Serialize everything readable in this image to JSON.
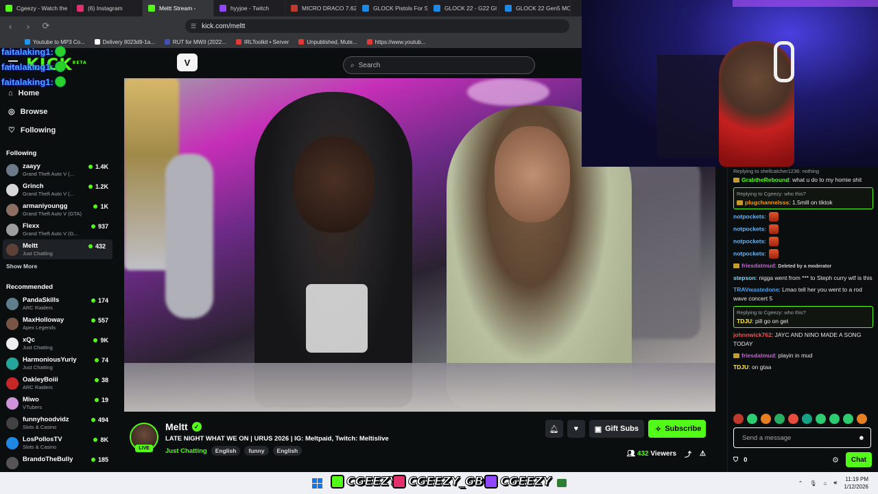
{
  "browser": {
    "tabs": [
      {
        "label": "Cgeezy - Watch the",
        "color": "#53fc18",
        "active": false
      },
      {
        "label": "(6) Instagram",
        "color": "#e1306c",
        "active": false
      },
      {
        "label": "Meltt Stream -",
        "color": "#53fc18",
        "active": true
      },
      {
        "label": "hyyjoe - Twitch",
        "color": "#9146ff",
        "active": false
      },
      {
        "label": "MICRO DRACO 7.62",
        "color": "#c0392b",
        "active": false
      },
      {
        "label": "GLOCK Pistols For S",
        "color": "#1e88e5",
        "active": false
      },
      {
        "label": "GLOCK 22 - G22 Gl",
        "color": "#1e88e5",
        "active": false
      },
      {
        "label": "GLOCK 22 Gen5 MO",
        "color": "#1e88e5",
        "active": false
      }
    ],
    "url": "kick.com/meltt",
    "bookmarks": [
      {
        "label": "Youtube to MP3 Co...",
        "color": "#2196f3"
      },
      {
        "label": "Delivery 8023d9-1a...",
        "color": "#ffffff"
      },
      {
        "label": "RUT for MWII (2022...",
        "color": "#3f51b5"
      },
      {
        "label": "IRLToolkit • Server",
        "color": "#e53935"
      },
      {
        "label": "Unpublished, Mute...",
        "color": "#e53935"
      },
      {
        "label": "https://www.youtub...",
        "color": "#e53935"
      }
    ]
  },
  "kick": {
    "logo": "KICK",
    "logo_beta": "BETA",
    "search_placeholder": "Search",
    "nav": [
      {
        "label": "Home",
        "icon": "home-icon"
      },
      {
        "label": "Browse",
        "icon": "compass-icon"
      },
      {
        "label": "Following",
        "icon": "heart-icon"
      }
    ],
    "following_header": "Following",
    "following": [
      {
        "name": "zaayy",
        "game": "Grand Theft Auto V (...",
        "viewers": "1.4K",
        "color": "#6c7a89"
      },
      {
        "name": "Grinch",
        "game": "Grand Theft Auto V (...",
        "viewers": "1.2K",
        "color": "#d8d8d8"
      },
      {
        "name": "armaniyoungg",
        "game": "Grand Theft Auto V (GTA)",
        "viewers": "1K",
        "color": "#8d6e63"
      },
      {
        "name": "Flexx",
        "game": "Grand Theft Auto V (G...",
        "viewers": "937",
        "color": "#9e9e9e"
      },
      {
        "name": "Meltt",
        "game": "Just Chatting",
        "viewers": "432",
        "color": "#5d4037"
      }
    ],
    "show_more": "Show More",
    "recommended_header": "Recommended",
    "recommended": [
      {
        "name": "PandaSkills",
        "game": "ARC Raiders",
        "viewers": "174",
        "color": "#607d8b"
      },
      {
        "name": "MaxHolloway",
        "game": "Apex Legends",
        "viewers": "557",
        "color": "#795548"
      },
      {
        "name": "xQc",
        "game": "Just Chatting",
        "viewers": "9K",
        "color": "#eeeeee"
      },
      {
        "name": "HarmoniousYuriy",
        "game": "Just Chatting",
        "viewers": "74",
        "color": "#26a69a"
      },
      {
        "name": "OakleyBoiii",
        "game": "ARC Raiders",
        "viewers": "38",
        "color": "#c62828"
      },
      {
        "name": "Miwo",
        "game": "VTubers",
        "viewers": "19",
        "color": "#ce93d8"
      },
      {
        "name": "funnyhoodvidz",
        "game": "Slots & Casino",
        "viewers": "494",
        "color": "#424242"
      },
      {
        "name": "LosPollosTV",
        "game": "Slots & Casino",
        "viewers": "8K",
        "color": "#1e88e5"
      },
      {
        "name": "BrandoTheBully",
        "game": "",
        "viewers": "185",
        "color": "#555555"
      }
    ],
    "overlay_chat": [
      "faitalaking1:",
      "faitalaking1:",
      "faitalaking1:"
    ],
    "stream": {
      "streamer": "Meltt",
      "live": "LIVE",
      "title": "LATE NIGHT WHAT WE ON | URUS 2026 | IG: Meltpaid, Twitch: Meltislive",
      "category": "Just Chatting",
      "tags": [
        "English",
        "funny",
        "English"
      ],
      "gift_label": "Gift Subs",
      "subscribe_label": "Subscribe",
      "viewers": "432",
      "viewers_label": "Viewers"
    },
    "chat": {
      "messages": [
        {
          "reply_to": "Replying to shellcatcher1236: nothing",
          "user": "GrabtheRebound",
          "user_color": "#53fc18",
          "text": "what u do to my homie shit",
          "badge": true,
          "highlight": false
        },
        {
          "reply_to": "Replying to Cgeezy: who this?",
          "user": "plugchannelsss",
          "user_color": "#ff9800",
          "text": "1.5mill on tiktok",
          "badge": true,
          "highlight": true
        },
        {
          "reply_to": "",
          "user": "notpockets",
          "user_color": "#64b5f6",
          "text": "",
          "emote": true,
          "badge": false,
          "highlight": false
        },
        {
          "reply_to": "",
          "user": "notpockets",
          "user_color": "#64b5f6",
          "text": "",
          "emote": true,
          "badge": false,
          "highlight": false
        },
        {
          "reply_to": "",
          "user": "notpockets",
          "user_color": "#64b5f6",
          "text": "",
          "emote": true,
          "badge": false,
          "highlight": false
        },
        {
          "reply_to": "",
          "user": "notpockets",
          "user_color": "#64b5f6",
          "text": "",
          "emote": true,
          "badge": false,
          "highlight": false
        },
        {
          "reply_to": "",
          "user": "friesdatmud",
          "user_color": "#ba68c8",
          "text": "",
          "mod_note": "Deleted by a moderator",
          "badge": true,
          "highlight": false
        },
        {
          "reply_to": "",
          "user": "stepson",
          "user_color": "#81d4fa",
          "text": "nigga went from *** to Steph curry wtf is this",
          "badge": false,
          "highlight": false
        },
        {
          "reply_to": "",
          "user": "TRAVwastedone",
          "user_color": "#42a5f5",
          "text": "Lmao tell her you went to a rod wave concert 5",
          "badge": false,
          "highlight": false
        },
        {
          "reply_to": "Replying to Cgeezy: who this?",
          "user": "TDJU",
          "user_color": "#ffeb3b",
          "text": "pill go on get",
          "badge": false,
          "highlight": true
        },
        {
          "reply_to": "",
          "user": "johnnwick762",
          "user_color": "#ef5350",
          "text": "JAYC AND NINO MADE A SONG TODAY",
          "badge": false,
          "highlight": false
        },
        {
          "reply_to": "",
          "user": "friesdatmud",
          "user_color": "#ba68c8",
          "text": "playin in mud",
          "badge": true,
          "highlight": false
        },
        {
          "reply_to": "",
          "user": "TDJU",
          "user_color": "#ffeb3b",
          "text": "on gtaa",
          "badge": false,
          "highlight": false
        }
      ],
      "input_placeholder": "Send a message",
      "points": "0",
      "chat_button": "Chat"
    }
  },
  "taskbar": {
    "brand1": "CGEEZY",
    "brand2": "CGEEZY_GBC",
    "brand3": "CGEEZY",
    "time": "11:19 PM",
    "date": "1/12/2026"
  }
}
